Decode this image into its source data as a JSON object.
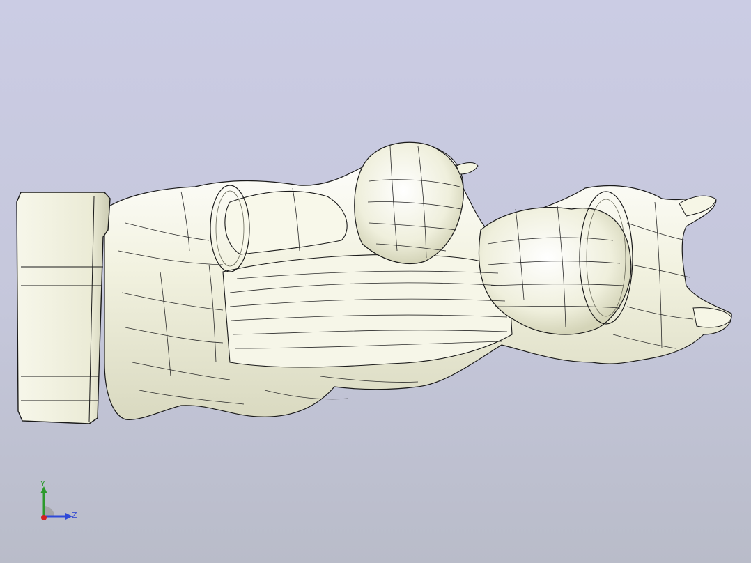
{
  "viewport": {
    "background_top": "#cbcce4",
    "background_bottom": "#b9bcc9",
    "model_fill": "#f4f4e6",
    "model_edge": "#1a1a1a"
  },
  "triad": {
    "y_label": "Y",
    "z_label": "Z",
    "y_color": "#2c9a2c",
    "z_color": "#2f49d8",
    "x_color": "#d42020"
  }
}
